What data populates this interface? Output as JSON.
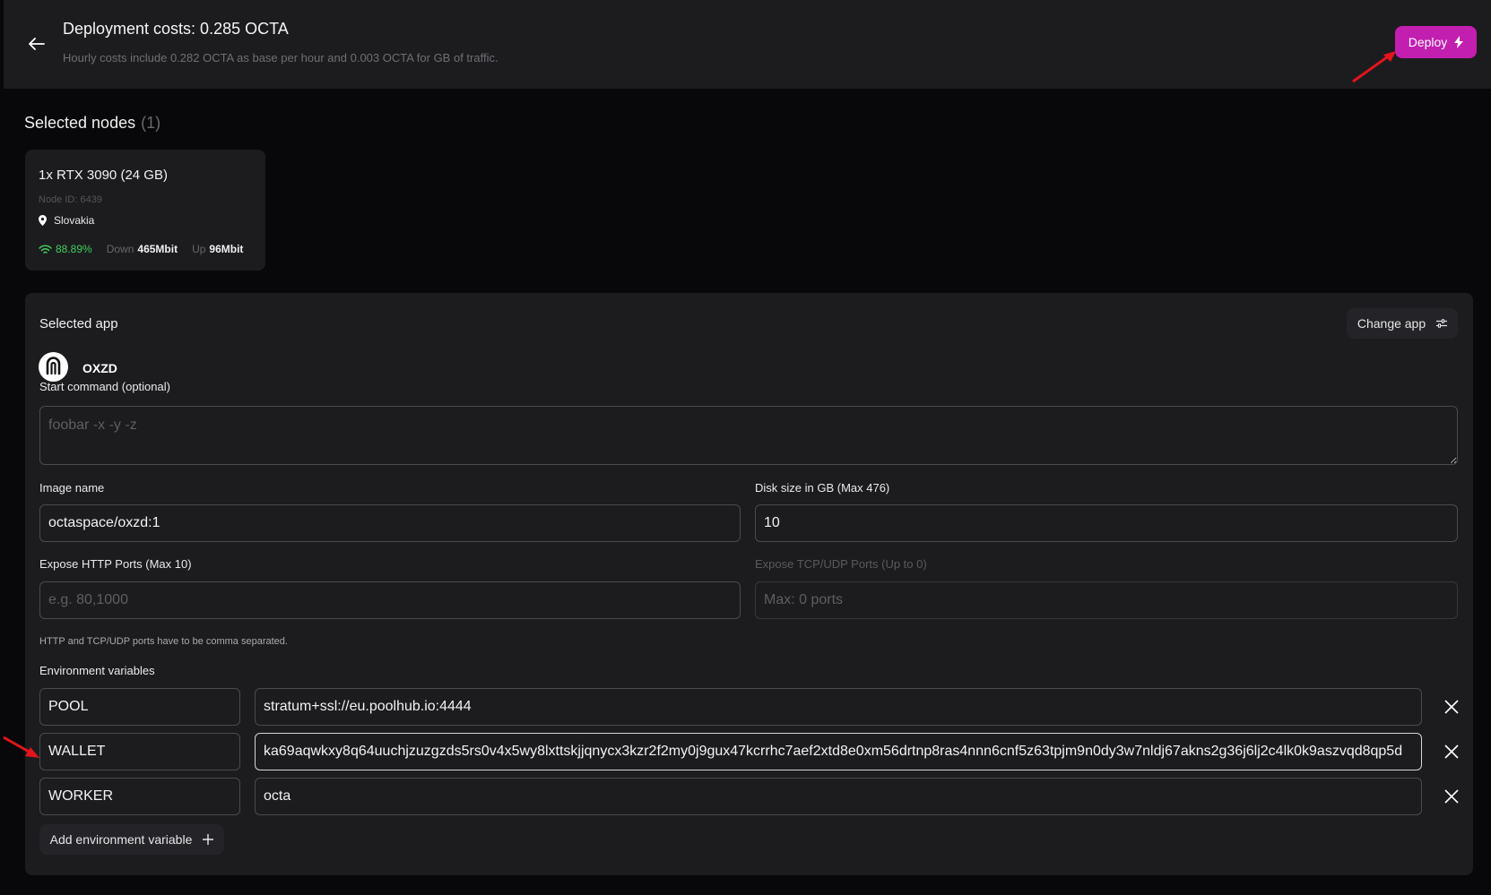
{
  "header": {
    "title": "Deployment costs: 0.285 OCTA",
    "subtitle": "Hourly costs include 0.282 OCTA as base per hour and 0.003 OCTA for GB of traffic.",
    "deploy_label": "Deploy"
  },
  "selected_nodes": {
    "title": "Selected nodes",
    "count": "(1)",
    "node": {
      "name": "1x RTX 3090 (24 GB)",
      "node_id": "Node ID: 6439",
      "location": "Slovakia",
      "signal": "88.89%",
      "down_label": "Down",
      "down_value": "465Mbit",
      "up_label": "Up",
      "up_value": "96Mbit"
    }
  },
  "selected_app": {
    "title": "Selected app",
    "change_label": "Change app",
    "app_name": "OXZD",
    "start_command_label": "Start command (optional)",
    "start_command_placeholder": "foobar -x -y -z",
    "image_name_label": "Image name",
    "image_name_value": "octaspace/oxzd:1",
    "disk_size_label": "Disk size in GB (Max 476)",
    "disk_size_value": "10",
    "http_ports_label": "Expose HTTP Ports (Max 10)",
    "http_ports_placeholder": "e.g. 80,1000",
    "tcp_ports_label": "Expose TCP/UDP Ports (Up to 0)",
    "tcp_ports_placeholder": "Max: 0 ports",
    "ports_hint": "HTTP and TCP/UDP ports have to be comma separated.",
    "env_label": "Environment variables",
    "env": [
      {
        "key": "POOL",
        "value": "stratum+ssl://eu.poolhub.io:4444"
      },
      {
        "key": "WALLET",
        "value": "ka69aqwkxy8q64uuchjzuzgzds5rs0v4x5wy8lxttskjjqnycx3kzr2f2my0j9gux47kcrrhc7aef2xtd8e0xm56drtnp8ras4nnn6cnf5z63tpjm9n0dy3w7nldj67akns2g36j6lj2c4lk0k9aszvqd8qp5d"
      },
      {
        "key": "WORKER",
        "value": "octa"
      }
    ],
    "add_env_label": "Add environment variable"
  },
  "colors": {
    "accent": "#c21fb0",
    "panel": "#1c1c1f",
    "background": "#08080a",
    "signal_green": "#3ecf5a",
    "annotation_red": "#e3141c"
  }
}
